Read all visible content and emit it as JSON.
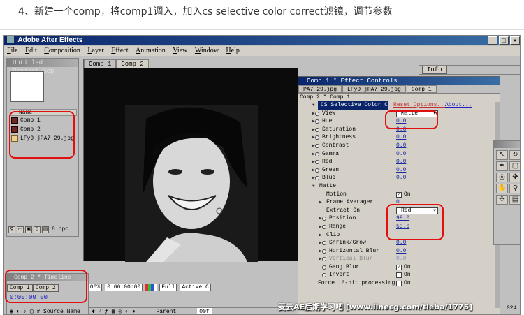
{
  "instruction": "4、新建一个comp，将comp1调入，加入cs selective color correct滤镜，调节参数",
  "window": {
    "title": "Adobe After Effects",
    "controls": [
      "_",
      "□",
      "×"
    ]
  },
  "menu": [
    "File",
    "Edit",
    "Composition",
    "Layer",
    "Effect",
    "Animation",
    "View",
    "Window",
    "Help"
  ],
  "project": {
    "title": "Untitled Project.aep",
    "column_name": "Name",
    "items": [
      {
        "name": "Comp 1",
        "type": "comp"
      },
      {
        "name": "Comp 2",
        "type": "comp"
      },
      {
        "name": "LFy9_jPA7_29.jpg",
        "type": "file"
      }
    ],
    "bpc": "8 bpc"
  },
  "viewer": {
    "tabs": [
      "Comp 1",
      "Comp 2"
    ],
    "zoom": "100%",
    "time": "0:00:00:00",
    "resolution": "Full",
    "camera": "Active C"
  },
  "timeline": {
    "title": "Comp 2 * Timeline",
    "tabs": [
      "Comp 1",
      "Comp 2"
    ],
    "time": "0:00:00:00",
    "source_label": "Source Name",
    "parent_label": "Parent",
    "timecode": "00f"
  },
  "info": {
    "tab": "Info"
  },
  "effect_controls": {
    "title": "Comp 1 * Effect Controls",
    "tabs": [
      "PA7_29.jpg",
      "LFy9_jPA7_29.jpg",
      "Comp 1"
    ],
    "comp_path": "Comp 2 * Comp 1",
    "effect_name": "CS Selective Color C",
    "reset": "Reset Options...",
    "about": "About...",
    "view": {
      "label": "View",
      "value": "Matte"
    },
    "params": [
      {
        "label": "Hue",
        "value": "0.0"
      },
      {
        "label": "Saturation",
        "value": "0.0"
      },
      {
        "label": "Brightness",
        "value": "0.0"
      },
      {
        "label": "Contrast",
        "value": "0.0"
      },
      {
        "label": "Gamma",
        "value": "0.0"
      },
      {
        "label": "Red",
        "value": "0.0"
      },
      {
        "label": "Green",
        "value": "0.0"
      },
      {
        "label": "Blue",
        "value": "0.0"
      }
    ],
    "matte": {
      "label": "Matte",
      "motion": {
        "label": "Motion",
        "value": "On"
      },
      "frame_averager": {
        "label": "Frame Averager",
        "value": "0"
      },
      "extract_on": {
        "label": "Extract On",
        "value": "Red"
      },
      "position": {
        "label": "Position",
        "value": "99.0"
      },
      "range": {
        "label": "Range",
        "value": "53.0"
      },
      "clip": {
        "label": "Clip"
      },
      "shrink_grow": {
        "label": "Shrink/Grow",
        "value": "0.0"
      },
      "horizontal_blur": {
        "label": "Horizontal Blur",
        "value": "0.0"
      },
      "vertical_blur": {
        "label": "Vertical Blur",
        "value": "0.0"
      },
      "gang_blur": {
        "label": "Gang Blur",
        "value": "On"
      },
      "invert": {
        "label": "Invert",
        "value": "On"
      }
    },
    "force16": {
      "label": "Force 16-bit processing",
      "value": "On"
    }
  },
  "corner_mark": "024",
  "watermark": "麦云AE后期学习吧 [www.linecg.com/tieba/1775]",
  "colors": {
    "annotation": "#e01010",
    "title_bar": "#0a246a",
    "value_link": "#1a2aa0"
  }
}
